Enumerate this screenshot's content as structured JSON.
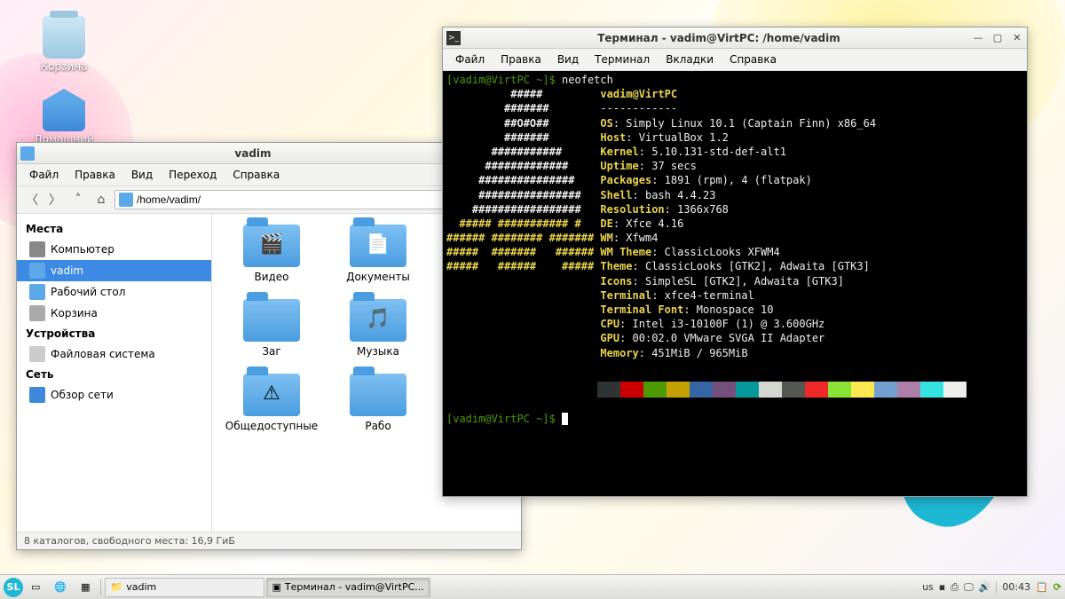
{
  "desktop": {
    "trash_label": "Корзина",
    "home_label": "Домашний"
  },
  "fm": {
    "title": "vadim",
    "menu": [
      "Файл",
      "Правка",
      "Вид",
      "Переход",
      "Справка"
    ],
    "path": "/home/vadim/",
    "sidebar": {
      "section_places": "Места",
      "section_devices": "Устройства",
      "section_network": "Сеть",
      "places": [
        {
          "label": "Компьютер",
          "color": "#888"
        },
        {
          "label": "vadim",
          "color": "#5da8e8",
          "selected": true
        },
        {
          "label": "Рабочий стол",
          "color": "#5da8e8"
        },
        {
          "label": "Корзина",
          "color": "#aaa"
        }
      ],
      "devices": [
        {
          "label": "Файловая система",
          "color": "#ccc"
        }
      ],
      "network": [
        {
          "label": "Обзор сети",
          "color": "#3d88d8"
        }
      ]
    },
    "folders": [
      {
        "label": "Видео",
        "overlay": "🎬"
      },
      {
        "label": "Документы",
        "overlay": "📄"
      },
      {
        "label": "Заг",
        "overlay": ""
      },
      {
        "label": "Музыка",
        "overlay": "🎵"
      },
      {
        "label": "Общедоступные",
        "overlay": "⚠"
      },
      {
        "label": "Рабо",
        "overlay": ""
      }
    ],
    "status": "8 каталогов, свободного места: 16,9 ГиБ"
  },
  "term": {
    "title": "Терминал - vadim@VirtPC: /home/vadim",
    "menu": [
      "Файл",
      "Правка",
      "Вид",
      "Терминал",
      "Вкладки",
      "Справка"
    ],
    "prompt": "[vadim@VirtPC ~]$ ",
    "cmd": "neofetch",
    "header": "vadim@VirtPC",
    "sep": "------------",
    "info": [
      {
        "k": "OS",
        "v": "Simply Linux 10.1 (Captain Finn) x86_64"
      },
      {
        "k": "Host",
        "v": "VirtualBox 1.2"
      },
      {
        "k": "Kernel",
        "v": "5.10.131-std-def-alt1"
      },
      {
        "k": "Uptime",
        "v": "37 secs"
      },
      {
        "k": "Packages",
        "v": "1891 (rpm), 4 (flatpak)"
      },
      {
        "k": "Shell",
        "v": "bash 4.4.23"
      },
      {
        "k": "Resolution",
        "v": "1366x768"
      },
      {
        "k": "DE",
        "v": "Xfce 4.16"
      },
      {
        "k": "WM",
        "v": "Xfwm4"
      },
      {
        "k": "WM Theme",
        "v": "ClassicLooks XFWM4"
      },
      {
        "k": "Theme",
        "v": "ClassicLooks [GTK2], Adwaita [GTK3]"
      },
      {
        "k": "Icons",
        "v": "SimpleSL [GTK2], Adwaita [GTK3]"
      },
      {
        "k": "Terminal",
        "v": "xfce4-terminal"
      },
      {
        "k": "Terminal Font",
        "v": "Monospace 10"
      },
      {
        "k": "CPU",
        "v": "Intel i3-10100F (1) @ 3.600GHz"
      },
      {
        "k": "GPU",
        "v": "00:02.0 VMware SVGA II Adapter"
      },
      {
        "k": "Memory",
        "v": "451MiB / 965MiB"
      }
    ],
    "ascii": [
      "          #####",
      "         #######",
      "         ##O#O##",
      "         #######",
      "       ###########",
      "      #############",
      "     ###############",
      "     ################",
      "    #################",
      "  ##### ########### #",
      "###### ######## #######",
      "#####  #######   ######",
      "#####   ######    #####"
    ],
    "swatches": [
      "#2e3436",
      "#cc0000",
      "#4e9a06",
      "#c4a000",
      "#3465a4",
      "#75507b",
      "#06989a",
      "#d3d7cf",
      "#555753",
      "#ef2929",
      "#8ae234",
      "#fce94f",
      "#729fcf",
      "#ad7fa8",
      "#34e2e2",
      "#eeeeec"
    ]
  },
  "taskbar": {
    "tasks": [
      {
        "label": "vadim",
        "icon": "📁"
      },
      {
        "label": "Терминал - vadim@VirtPC...",
        "icon": "▣",
        "active": true
      }
    ],
    "lang": "us",
    "clock": "00:43"
  }
}
